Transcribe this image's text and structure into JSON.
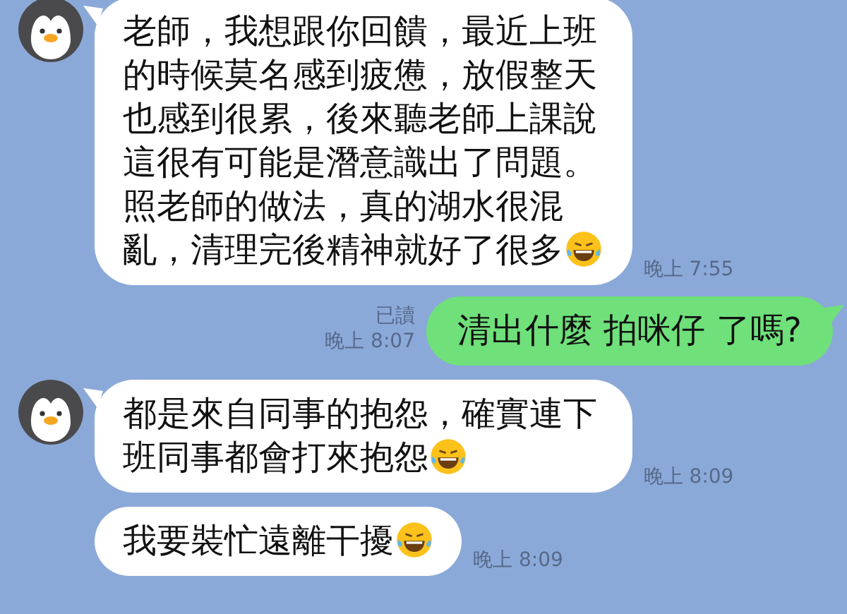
{
  "messages": [
    {
      "kind": "incoming",
      "show_avatar": true,
      "text": "老師，我想跟你回饋，最近上班的時候莫名感到疲憊，放假整天也感到很累，後來聽老師上課說這很有可能是潛意識出了問題。照老師的做法，真的湖水很混亂，清理完後精神就好了很多",
      "emoji": true,
      "time": "晚上 7:55"
    },
    {
      "kind": "outgoing",
      "text": "清出什麼 拍咪仔 了嗎?",
      "read": "已讀",
      "time": "晚上 8:07"
    },
    {
      "kind": "incoming",
      "show_avatar": true,
      "text": "都是來自同事的抱怨，確實連下班同事都會打來抱怨",
      "emoji": true,
      "time": "晚上 8:09"
    },
    {
      "kind": "incoming",
      "show_avatar": false,
      "text": "我要裝忙遠離干擾",
      "emoji": true,
      "time": "晚上 8:09"
    }
  ]
}
